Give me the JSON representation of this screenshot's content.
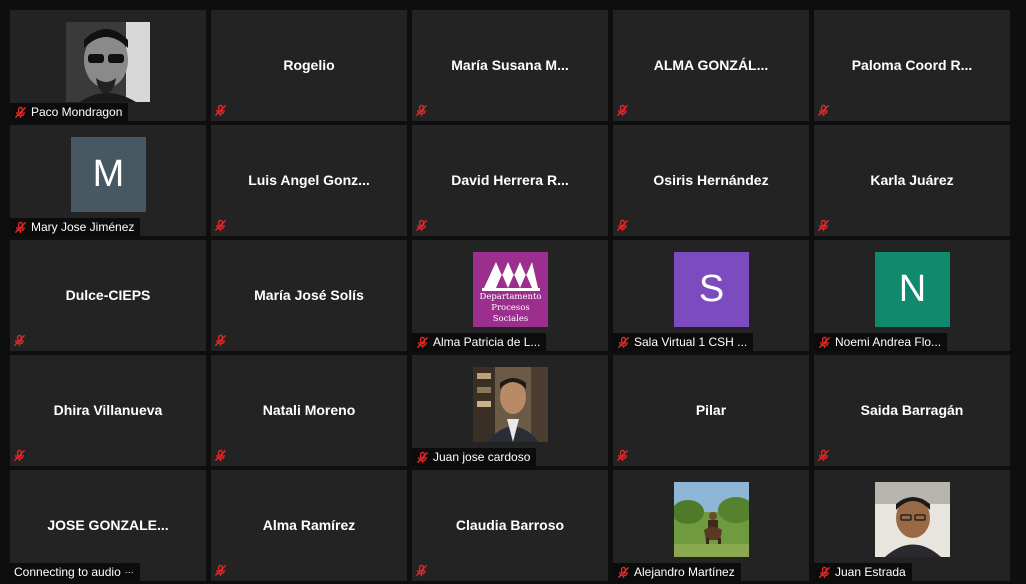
{
  "participants": [
    {
      "name": "Paco Mondragon",
      "type": "photo",
      "photo": "paco",
      "show_label": true
    },
    {
      "name": "Rogelio",
      "type": "name"
    },
    {
      "name": "María Susana M...",
      "type": "name"
    },
    {
      "name": "ALMA GONZÁL...",
      "type": "name"
    },
    {
      "name": "Paloma Coord R...",
      "type": "name"
    },
    {
      "name": "Mary Jose Jiménez",
      "type": "avatar",
      "initial": "M",
      "color": "#475862",
      "show_label": true
    },
    {
      "name": "Luis Angel Gonz...",
      "type": "name"
    },
    {
      "name": "David Herrera R...",
      "type": "name"
    },
    {
      "name": "Osiris Hernández",
      "type": "name"
    },
    {
      "name": "Karla Juárez",
      "type": "name"
    },
    {
      "name": "Dulce-CIEPS",
      "type": "name"
    },
    {
      "name": "María José Solís",
      "type": "name"
    },
    {
      "name": "Alma Patricia de L...",
      "type": "logo",
      "logo_line1": "Departamento",
      "logo_line2": "Procesos Sociales",
      "show_label": true
    },
    {
      "name": "Sala Virtual 1 CSH ...",
      "type": "avatar",
      "initial": "S",
      "color": "#7b4bbf",
      "show_label": true
    },
    {
      "name": "Noemi  Andrea Flo...",
      "type": "avatar",
      "initial": "N",
      "color": "#0f8a6d",
      "show_label": true
    },
    {
      "name": "Dhira Villanueva",
      "type": "name"
    },
    {
      "name": "Natali Moreno",
      "type": "name"
    },
    {
      "name": "Juan jose cardoso",
      "type": "photo",
      "photo": "juanjose",
      "show_label": true
    },
    {
      "name": "Pilar",
      "type": "name"
    },
    {
      "name": "Saida Barragán",
      "type": "name"
    },
    {
      "name": "JOSE  GONZALE...",
      "type": "name",
      "connecting_text": "Connecting to audio"
    },
    {
      "name": "Alma Ramírez",
      "type": "name"
    },
    {
      "name": "Claudia Barroso",
      "type": "name"
    },
    {
      "name": "Alejandro Martínez",
      "type": "photo",
      "photo": "alejandro",
      "show_label": true
    },
    {
      "name": "Juan Estrada",
      "type": "photo",
      "photo": "juanestrada",
      "show_label": true
    }
  ],
  "colors": {
    "tile_bg": "#232323",
    "page_bg": "#0e0e0e",
    "mute_red": "#e02828",
    "logo_bg": "#9c2e8d"
  },
  "icons": {
    "muted": "microphone-muted-icon"
  }
}
